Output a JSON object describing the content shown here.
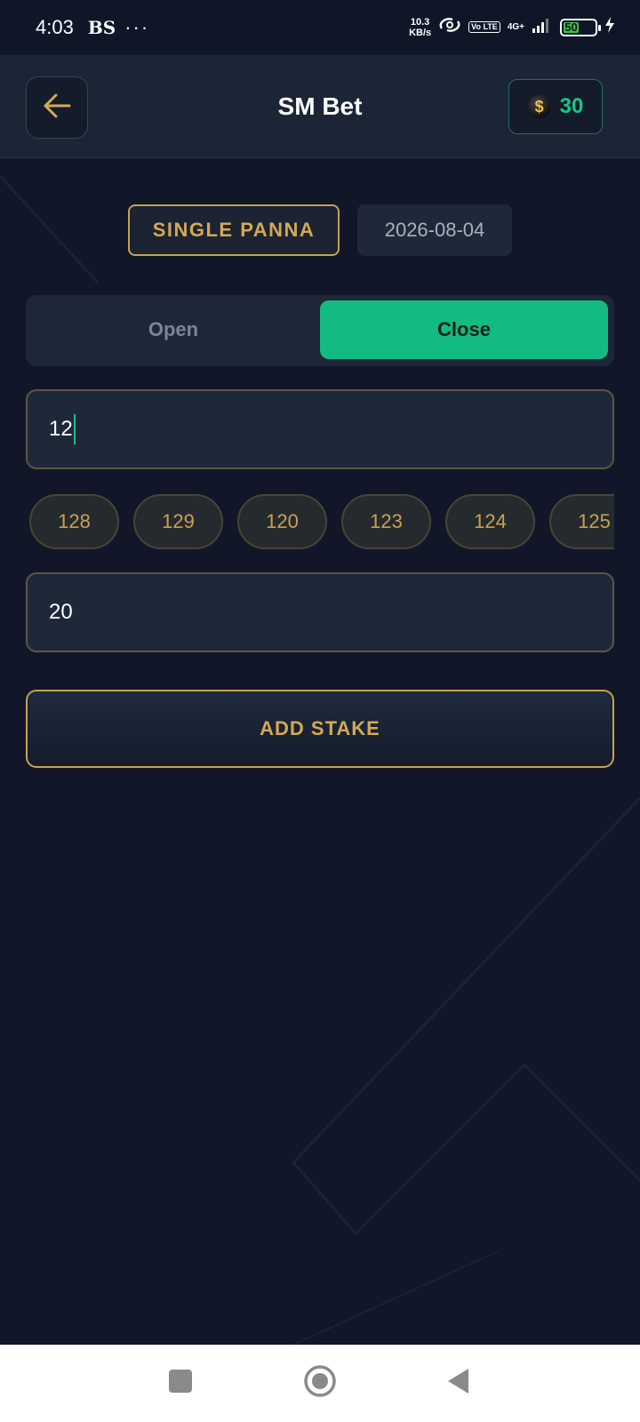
{
  "status_bar": {
    "time": "4:03",
    "carrier": "BS",
    "dots": "···",
    "net_speed_value": "10.3",
    "net_speed_unit": "KB/s",
    "volte": "Vo LTE",
    "network": "4G+",
    "battery": "50",
    "battery_level": 0.5
  },
  "header": {
    "title": "SM Bet",
    "balance": "30",
    "coin_symbol": "$"
  },
  "game": {
    "type": "SINGLE PANNA",
    "date": "2026-08-04"
  },
  "session": {
    "open_label": "Open",
    "close_label": "Close",
    "selected": "Close"
  },
  "number_input": {
    "value": "12"
  },
  "suggestions": [
    "128",
    "129",
    "120",
    "123",
    "124",
    "125"
  ],
  "amount_input": {
    "value": "20"
  },
  "add_stake_label": "ADD STAKE",
  "colors": {
    "background": "#111729",
    "accent_gold": "#d4a954",
    "accent_green": "#13bb82"
  }
}
